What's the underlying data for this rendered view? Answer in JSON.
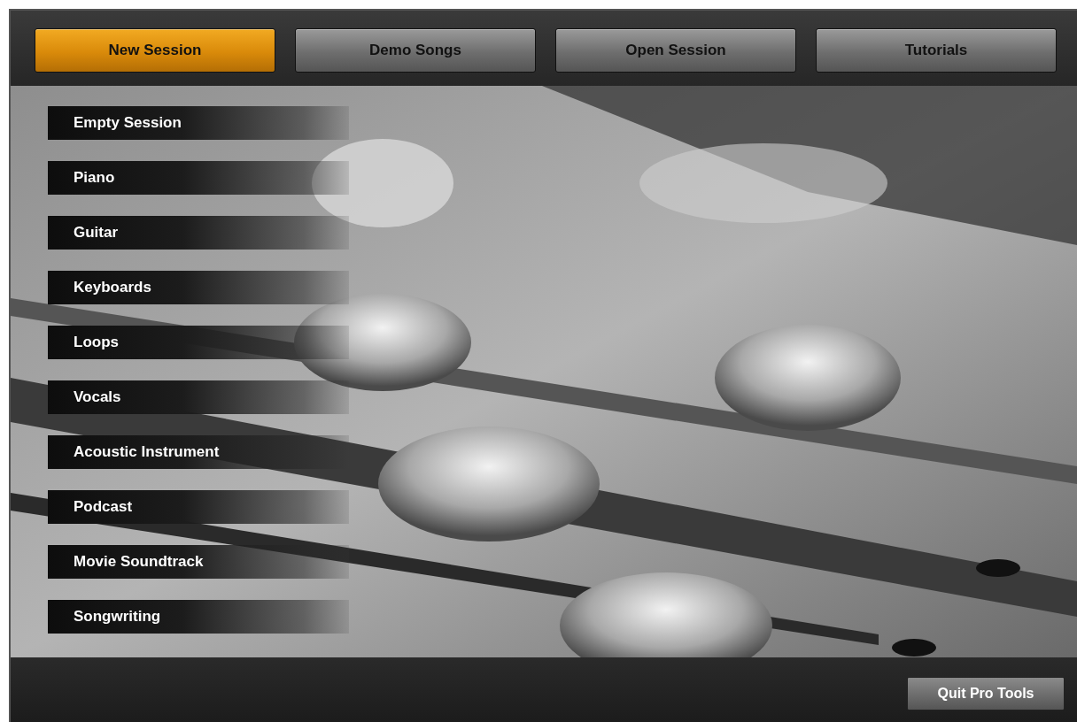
{
  "tabs": [
    {
      "label": "New Session",
      "selected": true
    },
    {
      "label": "Demo Songs",
      "selected": false
    },
    {
      "label": "Open Session",
      "selected": false
    },
    {
      "label": "Tutorials",
      "selected": false
    }
  ],
  "templates": [
    {
      "label": "Empty Session"
    },
    {
      "label": "Piano"
    },
    {
      "label": "Guitar"
    },
    {
      "label": "Keyboards"
    },
    {
      "label": "Loops"
    },
    {
      "label": "Vocals"
    },
    {
      "label": "Acoustic Instrument"
    },
    {
      "label": "Podcast"
    },
    {
      "label": "Movie Soundtrack"
    },
    {
      "label": "Songwriting"
    }
  ],
  "footer": {
    "quit_button": "Quit Pro Tools"
  }
}
